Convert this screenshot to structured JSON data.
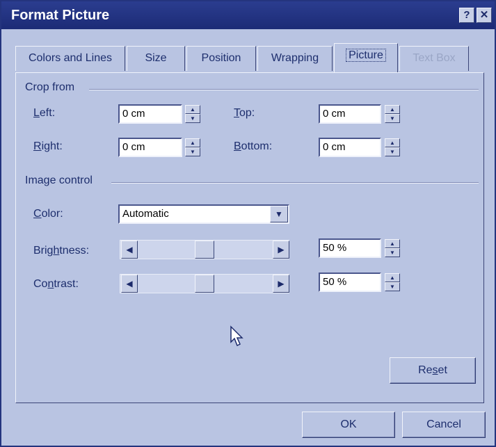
{
  "window": {
    "title": "Format Picture",
    "help_label": "?",
    "close_label": "✕"
  },
  "tabs": [
    {
      "label": "Colors and Lines",
      "state": "normal"
    },
    {
      "label": "Size",
      "state": "normal"
    },
    {
      "label": "Position",
      "state": "normal"
    },
    {
      "label": "Wrapping",
      "state": "normal"
    },
    {
      "label": "Picture",
      "state": "active"
    },
    {
      "label": "Text Box",
      "state": "disabled"
    }
  ],
  "crop": {
    "section_label": "Crop from",
    "left": {
      "label_key": "L",
      "label_rest": "eft:",
      "value": "0 cm"
    },
    "top": {
      "label_key": "T",
      "label_rest": "op:",
      "value": "0 cm"
    },
    "right": {
      "label_key": "R",
      "label_rest": "ight:",
      "value": "0 cm"
    },
    "bottom": {
      "label_key": "B",
      "label_rest": "ottom:",
      "value": "0 cm"
    }
  },
  "image_control": {
    "section_label": "Image control",
    "color": {
      "label_key": "C",
      "label_rest": "olor:",
      "value": "Automatic"
    },
    "brightness": {
      "label_pre": "Brig",
      "label_key": "h",
      "label_rest": "tness:",
      "value": "50 %",
      "level": 0.5
    },
    "contrast": {
      "label_pre": "Co",
      "label_key": "n",
      "label_rest": "trast:",
      "value": "50 %",
      "level": 0.5
    }
  },
  "buttons": {
    "reset": {
      "pre": "Re",
      "key": "s",
      "rest": "et"
    },
    "ok": "OK",
    "cancel": "Cancel"
  },
  "icons": {
    "spin_up": "▲",
    "spin_down": "▼",
    "combo_arrow": "▼",
    "slider_left": "◀",
    "slider_right": "▶"
  },
  "colors": {
    "titlebar": "#1c2b76",
    "dialog_bg": "#b9c4e2",
    "text": "#1d2e6d"
  }
}
